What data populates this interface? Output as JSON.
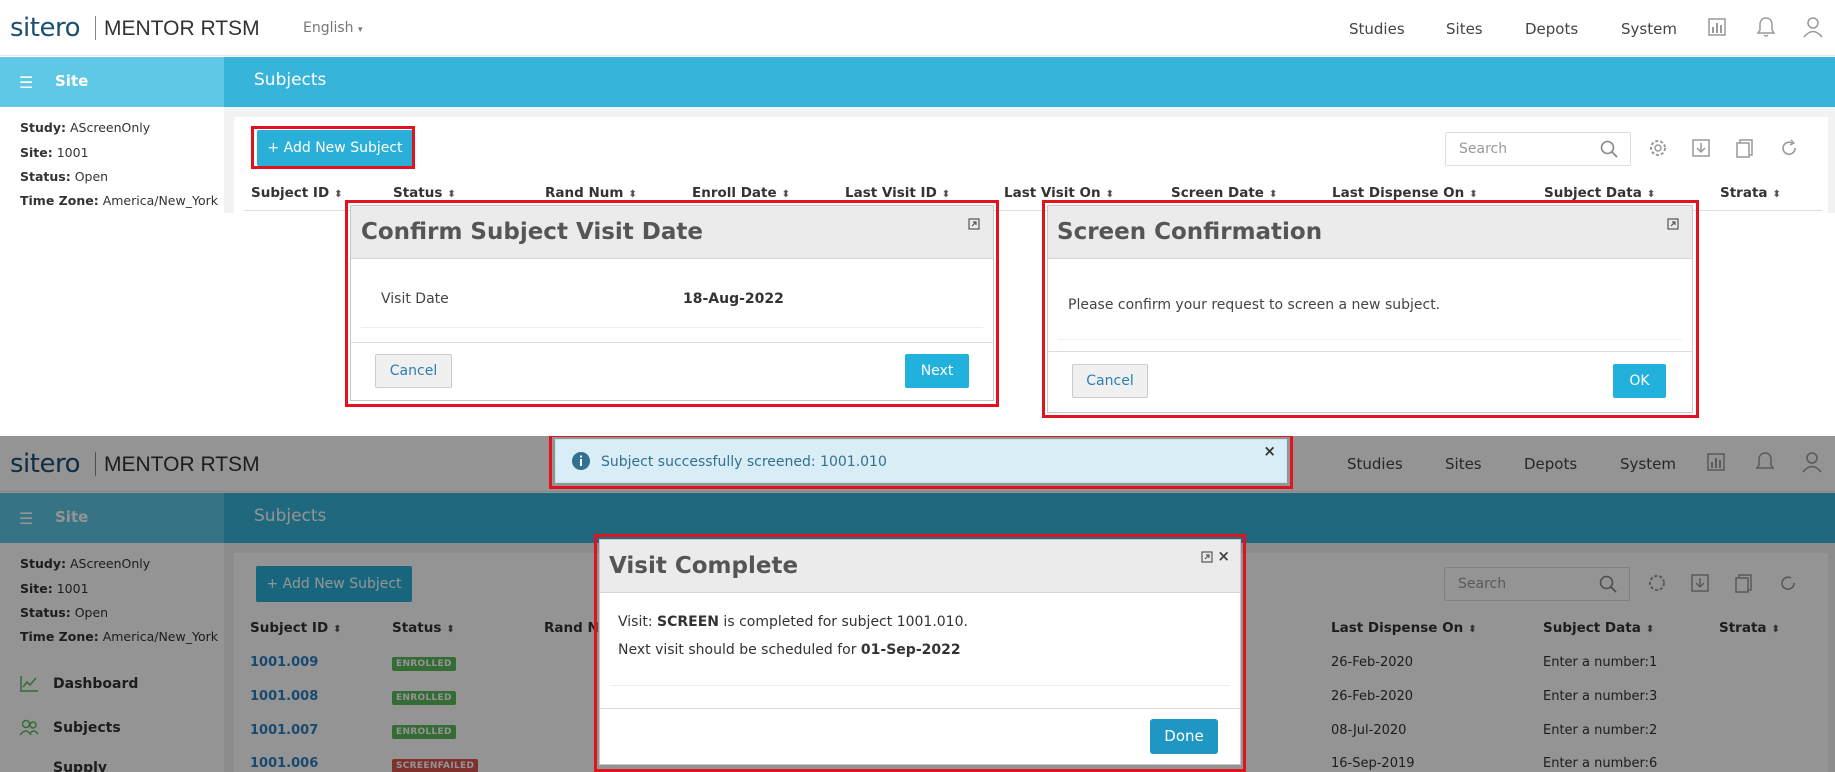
{
  "nav": {
    "logo": "sitero",
    "product": "MENTOR RTSM",
    "language": "English",
    "links": [
      "Studies",
      "Sites",
      "Depots",
      "System"
    ]
  },
  "sidebar": {
    "title": "Site",
    "study_label": "Study:",
    "study_value": "AScreenOnly",
    "site_label": "Site:",
    "site_value": "1001",
    "status_label": "Status:",
    "status_value": "Open",
    "timezone_label": "Time Zone:",
    "timezone_value": "America/New_York",
    "menu": [
      "Dashboard",
      "Subjects",
      "Supply"
    ]
  },
  "page": {
    "title": "Subjects",
    "add_button": "+ Add New Subject",
    "search_placeholder": "Search"
  },
  "table": {
    "headers": [
      "Subject ID",
      "Status",
      "Rand Num",
      "Enroll Date",
      "Last Visit ID",
      "Last Visit On",
      "Screen Date",
      "Last Dispense On",
      "Subject Data",
      "Strata"
    ],
    "bottom_headers": [
      "Subject ID",
      "Status",
      "Rand N...",
      "Last Dispense On",
      "Subject Data",
      "Strata"
    ],
    "rows": [
      {
        "id": "1001.009",
        "status": "ENROLLED",
        "last_dispense": "26-Feb-2020",
        "subject_data": "Enter a number:1"
      },
      {
        "id": "1001.008",
        "status": "ENROLLED",
        "last_dispense": "26-Feb-2020",
        "subject_data": "Enter a number:3"
      },
      {
        "id": "1001.007",
        "status": "ENROLLED",
        "last_dispense": "08-Jul-2020",
        "subject_data": "Enter a number:2"
      },
      {
        "id": "1001.006",
        "status": "SCREENFAILED",
        "last_dispense": "16-Sep-2019",
        "subject_data": "Enter a number:6"
      }
    ]
  },
  "modal_visit_date": {
    "title": "Confirm Subject Visit Date",
    "label": "Visit Date",
    "value": "18-Aug-2022",
    "cancel": "Cancel",
    "next": "Next"
  },
  "modal_screen": {
    "title": "Screen Confirmation",
    "message": "Please confirm your request to screen a new subject.",
    "cancel": "Cancel",
    "ok": "OK"
  },
  "alert": {
    "message": "Subject successfully screened: 1001.010",
    "close": "×"
  },
  "modal_complete": {
    "title": "Visit Complete",
    "line1_prefix": "Visit: ",
    "line1_bold": "SCREEN",
    "line1_suffix": " is completed for subject 1001.010.",
    "line2_prefix": "Next visit should be scheduled for ",
    "line2_bold": "01-Sep-2022",
    "done": "Done",
    "close": "×"
  },
  "colors": {
    "accent": "#36b4d9",
    "button": "#2ab0d8",
    "highlight": "#e0141e",
    "enrolled": "#5cb85c",
    "screenfailed": "#d9534f"
  }
}
